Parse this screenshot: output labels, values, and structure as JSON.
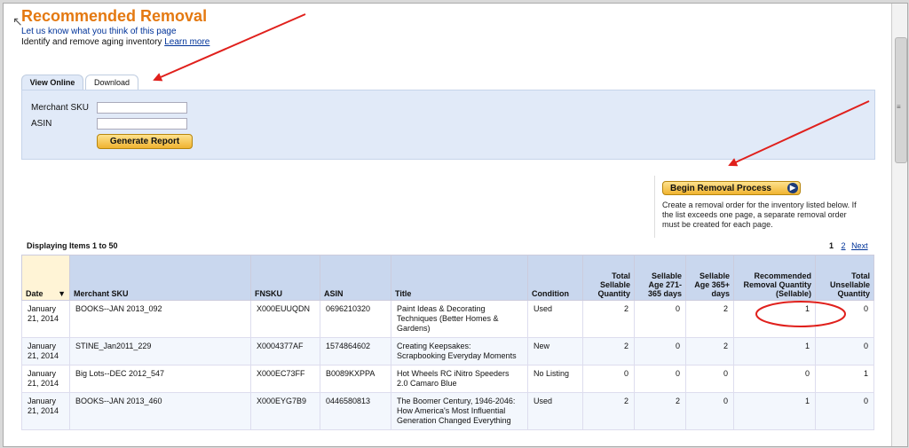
{
  "header": {
    "title": "Recommended Removal",
    "feedback_link": "Let us know what you think of this page",
    "subtitle": "Identify and remove aging inventory",
    "learn_more": "Learn more"
  },
  "tabs": [
    {
      "label": "View Online",
      "active": true
    },
    {
      "label": "Download",
      "active": false
    }
  ],
  "filters": {
    "merchant_sku_label": "Merchant SKU",
    "merchant_sku_value": "",
    "asin_label": "ASIN",
    "asin_value": "",
    "generate_button": "Generate Report"
  },
  "removal": {
    "button": "Begin Removal Process",
    "description": "Create a removal order for the inventory listed below. If the list exceeds one page, a separate removal order must be created for each page."
  },
  "listing": {
    "display_text": "Displaying Items 1 to 50",
    "pager": {
      "current": "1",
      "next_page": "2",
      "next_label": "Next"
    }
  },
  "table": {
    "columns": [
      "Date",
      "Merchant SKU",
      "FNSKU",
      "ASIN",
      "Title",
      "Condition",
      "Total Sellable Quantity",
      "Sellable Age 271-365 days",
      "Sellable Age 365+ days",
      "Recommended Removal Quantity (Sellable)",
      "Total Unsellable Quantity"
    ],
    "rows": [
      {
        "date": "January 21, 2014",
        "sku": "BOOKS--JAN 2013_092",
        "fnsku": "X000EUUQDN",
        "asin": "0696210320",
        "title": "Paint Ideas & Decorating Techniques (Better Homes & Gardens)",
        "condition": "Used",
        "total": "2",
        "age271": "0",
        "age365": "2",
        "recommended": "1",
        "unsellable": "0"
      },
      {
        "date": "January 21, 2014",
        "sku": "STINE_Jan2011_229",
        "fnsku": "X0004377AF",
        "asin": "1574864602",
        "title": "Creating Keepsakes: Scrapbooking Everyday Moments",
        "condition": "New",
        "total": "2",
        "age271": "0",
        "age365": "2",
        "recommended": "1",
        "unsellable": "0"
      },
      {
        "date": "January 21, 2014",
        "sku": "Big Lots--DEC 2012_547",
        "fnsku": "X000EC73FF",
        "asin": "B0089KXPPA",
        "title": "Hot Wheels RC iNitro Speeders 2.0 Camaro Blue",
        "condition": "No Listing",
        "total": "0",
        "age271": "0",
        "age365": "0",
        "recommended": "0",
        "unsellable": "1"
      },
      {
        "date": "January 21, 2014",
        "sku": "BOOKS--JAN 2013_460",
        "fnsku": "X000EYG7B9",
        "asin": "0446580813",
        "title": "The Boomer Century, 1946-2046: How America's Most Influential Generation Changed Everything",
        "condition": "Used",
        "total": "2",
        "age271": "2",
        "age365": "0",
        "recommended": "1",
        "unsellable": "0"
      }
    ]
  },
  "colors": {
    "title": "#e47911",
    "link": "#003399",
    "panel": "#e1eaf8",
    "annotation": "#e0201c"
  }
}
